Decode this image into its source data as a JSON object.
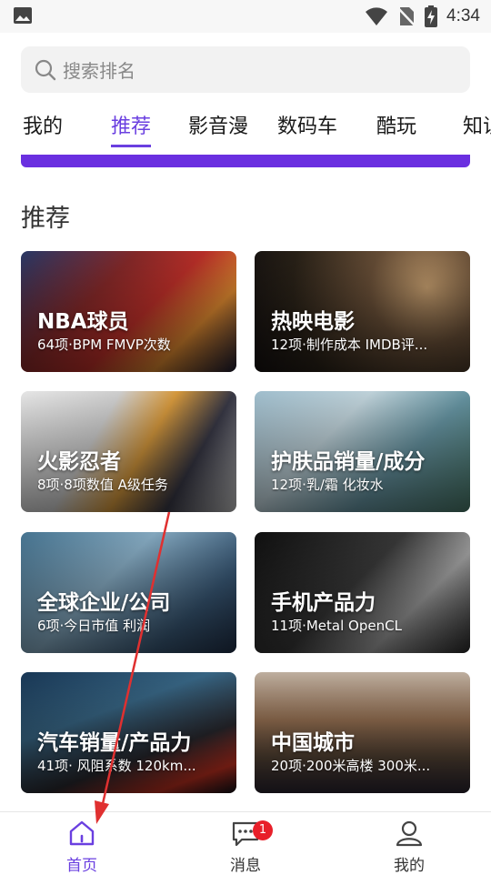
{
  "status_bar": {
    "time": "4:34"
  },
  "search": {
    "placeholder": "搜索排名"
  },
  "tabs": [
    {
      "label": "我的",
      "active": false
    },
    {
      "label": "推荐",
      "active": true
    },
    {
      "label": "影音漫",
      "active": false
    },
    {
      "label": "数码车",
      "active": false
    },
    {
      "label": "酷玩",
      "active": false
    },
    {
      "label": "知识",
      "active": false
    }
  ],
  "section": {
    "title": "推荐"
  },
  "cards": [
    {
      "title": "NBA球员",
      "subtitle": "64项·BPM FMVP次数"
    },
    {
      "title": "热映电影",
      "subtitle": "12项·制作成本 IMDB评..."
    },
    {
      "title": "火影忍者",
      "subtitle": "8项·8项数值 A级任务"
    },
    {
      "title": "护肤品销量/成分",
      "subtitle": "12项·乳/霜 化妆水"
    },
    {
      "title": "全球企业/公司",
      "subtitle": "6项·今日市值 利润"
    },
    {
      "title": "手机产品力",
      "subtitle": "11项·Metal OpenCL"
    },
    {
      "title": "汽车销量/产品力",
      "subtitle": "41项· 风阻系数 120km..."
    },
    {
      "title": "中国城市",
      "subtitle": "20项·200米高楼 300米..."
    }
  ],
  "bottom_nav": {
    "home": {
      "label": "首页",
      "icon": "home-icon",
      "active": true
    },
    "messages": {
      "label": "消息",
      "icon": "message-icon",
      "badge": "1"
    },
    "profile": {
      "label": "我的",
      "icon": "person-icon"
    }
  },
  "colors": {
    "accent": "#6a3fe0",
    "badge": "#e8202a",
    "annotation_arrow": "#e03030"
  }
}
